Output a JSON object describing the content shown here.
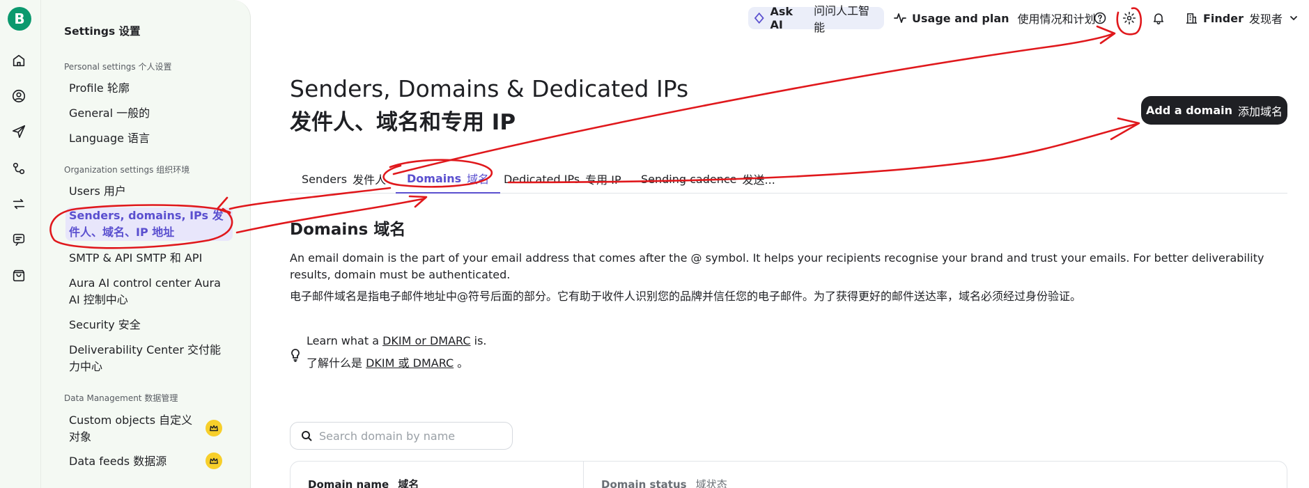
{
  "rail": {
    "logo": "B",
    "icons": [
      "home-icon",
      "contacts-icon",
      "send-icon",
      "automation-icon",
      "transactional-icon",
      "conversations-icon",
      "shopping-bag-icon"
    ]
  },
  "sidebar": {
    "title": "Settings  设置",
    "personal_section": "Personal settings  个人设置",
    "personal_items": [
      "Profile  轮廓",
      "General  一般的",
      "Language  语言"
    ],
    "org_section": "Organization settings  组织环境",
    "org_items": [
      "Users  用户",
      "Senders, domains, IPs  发件人、域名、IP 地址",
      "SMTP & API  SMTP 和 API",
      "Aura AI control center  Aura AI 控制中心",
      "Security  安全",
      "Deliverability Center  交付能力中心"
    ],
    "data_section": "Data Management  数据管理",
    "data_items": [
      "Custom objects  自定义对象",
      "Data feeds  数据源"
    ]
  },
  "topbar": {
    "ask_ai": "Ask AI",
    "ask_ai_sub": "问问人工智能",
    "usage": "Usage and plan",
    "usage_sub": "使用情况和计划",
    "finder": "Finder",
    "finder_sub": "发现者"
  },
  "main": {
    "title": "Senders, Domains & Dedicated IPs",
    "title_zh": "发件人、域名和专用 IP",
    "add_button": "Add a domain",
    "add_button_sub": "添加域名",
    "tabs": [
      {
        "label": "Senders",
        "sub": "发件人"
      },
      {
        "label": "Domains",
        "sub": "域名"
      },
      {
        "label": "Dedicated IPs",
        "sub": "专用 IP"
      },
      {
        "label": "Sending cadence",
        "sub": "发送..."
      }
    ],
    "section_title": "Domains  域名",
    "description": "An email domain is the part of your email address that comes after the @ symbol. It helps your recipients recognise your brand and trust your emails. For better deliverability results, domain must be authenticated.",
    "description_zh": "电子邮件域名是指电子邮件地址中@符号后面的部分。它有助于收件人识别您的品牌并信任您的电子邮件。为了获得更好的邮件送达率，域名必须经过身份验证。",
    "learn_prefix": "Learn what a",
    "learn_link": "DKIM or DMARC",
    "learn_suffix": "is.",
    "learn_prefix_zh": "了解什么是",
    "learn_link_zh": "DKIM 或 DMARC",
    "learn_suffix_zh": "。",
    "search_placeholder": "Search domain by name",
    "table_headers": [
      {
        "label": "Domain name",
        "sub": "域名"
      },
      {
        "label": "Domain status",
        "sub": "域状态"
      }
    ]
  },
  "colors": {
    "accent": "#5a4fcf",
    "brand": "#0b996e",
    "annotation": "#e0181c"
  }
}
